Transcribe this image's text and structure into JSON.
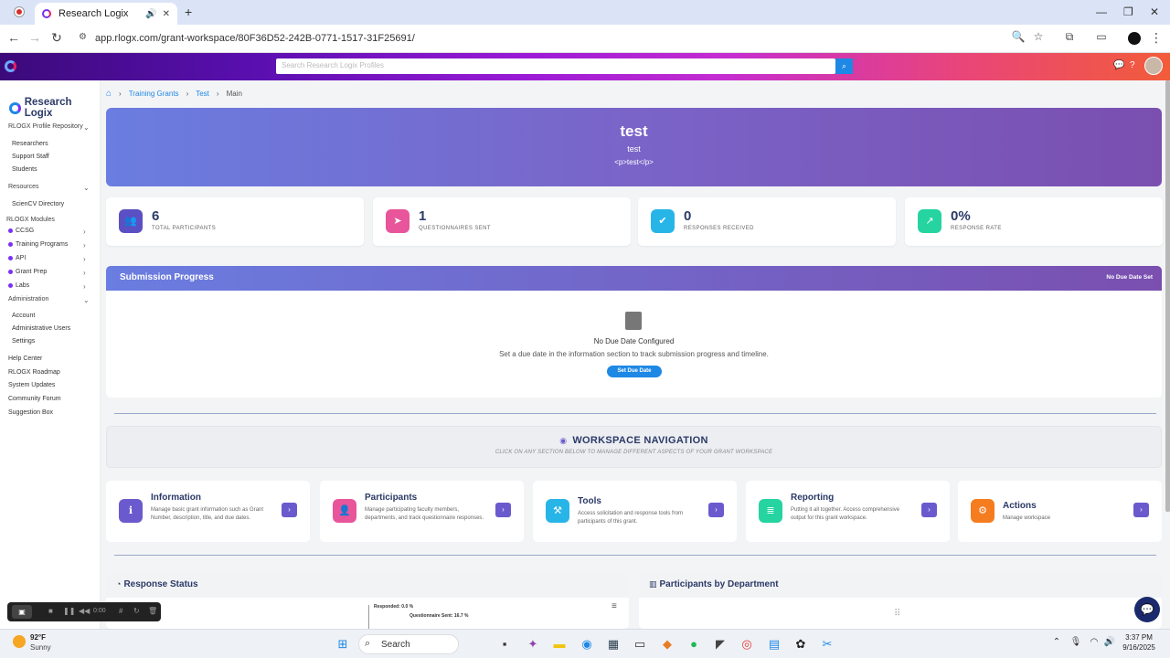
{
  "browser": {
    "tab_title": "Research Logix",
    "url": "app.rlogx.com/grant-workspace/80F36D52-242B-0771-1517-31F25691/"
  },
  "header": {
    "search_placeholder": "Search Research Logix Profiles"
  },
  "sidebar": {
    "logo": "Research Logix",
    "repo_title": "RLOGX Profile Repository",
    "repo_items": [
      "Researchers",
      "Support Staff",
      "Students"
    ],
    "resources_title": "Resources",
    "resources_items": [
      "ScienCV Directory"
    ],
    "modules_title": "RLOGX Modules",
    "modules": [
      "CCSG",
      "Training Programs",
      "API",
      "Grant Prep",
      "Labs"
    ],
    "admin_title": "Administration",
    "admin_items": [
      "Account",
      "Administrative Users",
      "Settings"
    ],
    "footer_items": [
      "Help Center",
      "RLOGX Roadmap",
      "System Updates",
      "Community Forum",
      "Suggestion Box"
    ]
  },
  "breadcrumb": {
    "items": [
      "Training Grants",
      "Test",
      "Main"
    ]
  },
  "hero": {
    "title": "test",
    "subtitle": "test",
    "description": "<p>test</p>"
  },
  "stats": [
    {
      "value": "6",
      "label": "TOTAL PARTICIPANTS",
      "color": "#5b4fc4"
    },
    {
      "value": "1",
      "label": "QUESTIONNAIRES SENT",
      "color": "#e8559a"
    },
    {
      "value": "0",
      "label": "RESPONSES RECEIVED",
      "color": "#27b5e8"
    },
    {
      "value": "0%",
      "label": "RESPONSE RATE",
      "color": "#25d4a0"
    }
  ],
  "progress": {
    "title": "Submission Progress",
    "badge": "No Due Date Set",
    "empty_title": "No Due Date Configured",
    "empty_text": "Set a due date in the information section to track submission progress and timeline.",
    "button": "Set Due Date"
  },
  "workspace_nav": {
    "title": "WORKSPACE NAVIGATION",
    "subtitle": "CLICK ON ANY SECTION BELOW TO MANAGE DIFFERENT ASPECTS OF YOUR GRANT WORKSPACE"
  },
  "cards": [
    {
      "title": "Information",
      "desc": "Manage basic grant information such as Grant Number, description, title, and due dates.",
      "color": "#6a5acd"
    },
    {
      "title": "Participants",
      "desc": "Manage participating faculty members, departments, and track questionnaire responses.",
      "color": "#e8559a"
    },
    {
      "title": "Tools",
      "desc": "Access solicitation and response tools from participants of this grant.",
      "color": "#27b5e8"
    },
    {
      "title": "Reporting",
      "desc": "Putting it all together. Access comprehensive output for this grant workspace.",
      "color": "#25d4a0"
    },
    {
      "title": "Actions",
      "desc": "Manage workspace",
      "color": "#f57c1f"
    }
  ],
  "panels": {
    "response_status": "Response Status",
    "participants_by_dept": "Participants by Department",
    "chart_labels": [
      "Responded: 0.0 %",
      "Questionnaire Sent: 16.7 %"
    ]
  },
  "recorder": {
    "time": "0:00"
  },
  "taskbar": {
    "weather_temp": "92°F",
    "weather_desc": "Sunny",
    "search": "Search",
    "time": "3:37 PM",
    "date": "9/16/2025"
  }
}
